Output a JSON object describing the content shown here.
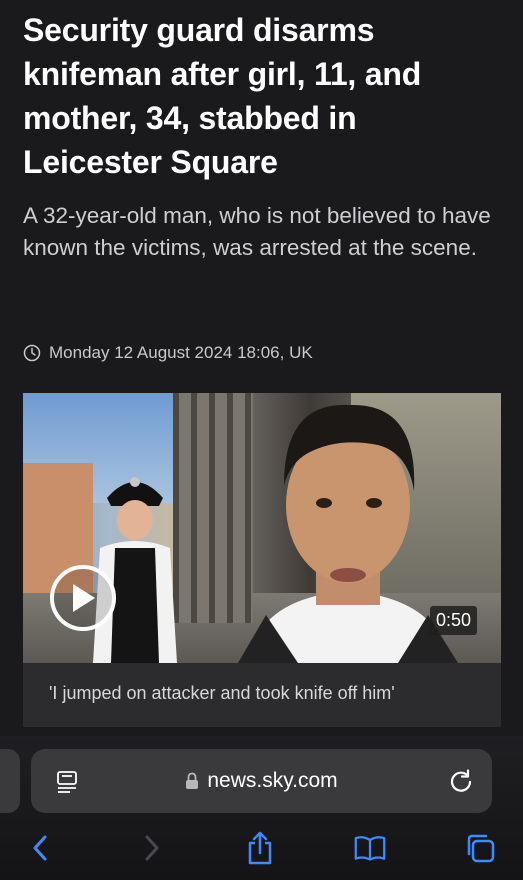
{
  "article": {
    "headline": "Security guard disarms knifeman after girl, 11, and mother, 34, stabbed in Leicester Square",
    "standfirst": "A 32-year-old man, who is not believed to have known the victims, was arrested at the scene.",
    "timestamp": "Monday 12 August 2024 18:06, UK"
  },
  "video": {
    "duration": "0:50",
    "caption": "'I jumped on attacker and took knife off him'"
  },
  "browser": {
    "url": "news.sky.com",
    "accent_color": "#3d8bff"
  },
  "icons": {
    "clock": "clock-icon",
    "play": "play-icon",
    "reader": "reader-mode-icon",
    "lock": "lock-icon",
    "reload": "reload-icon",
    "back": "chevron-left-icon",
    "forward": "chevron-right-icon",
    "share": "share-icon",
    "bookmarks": "book-icon",
    "tabs": "tabs-icon"
  }
}
